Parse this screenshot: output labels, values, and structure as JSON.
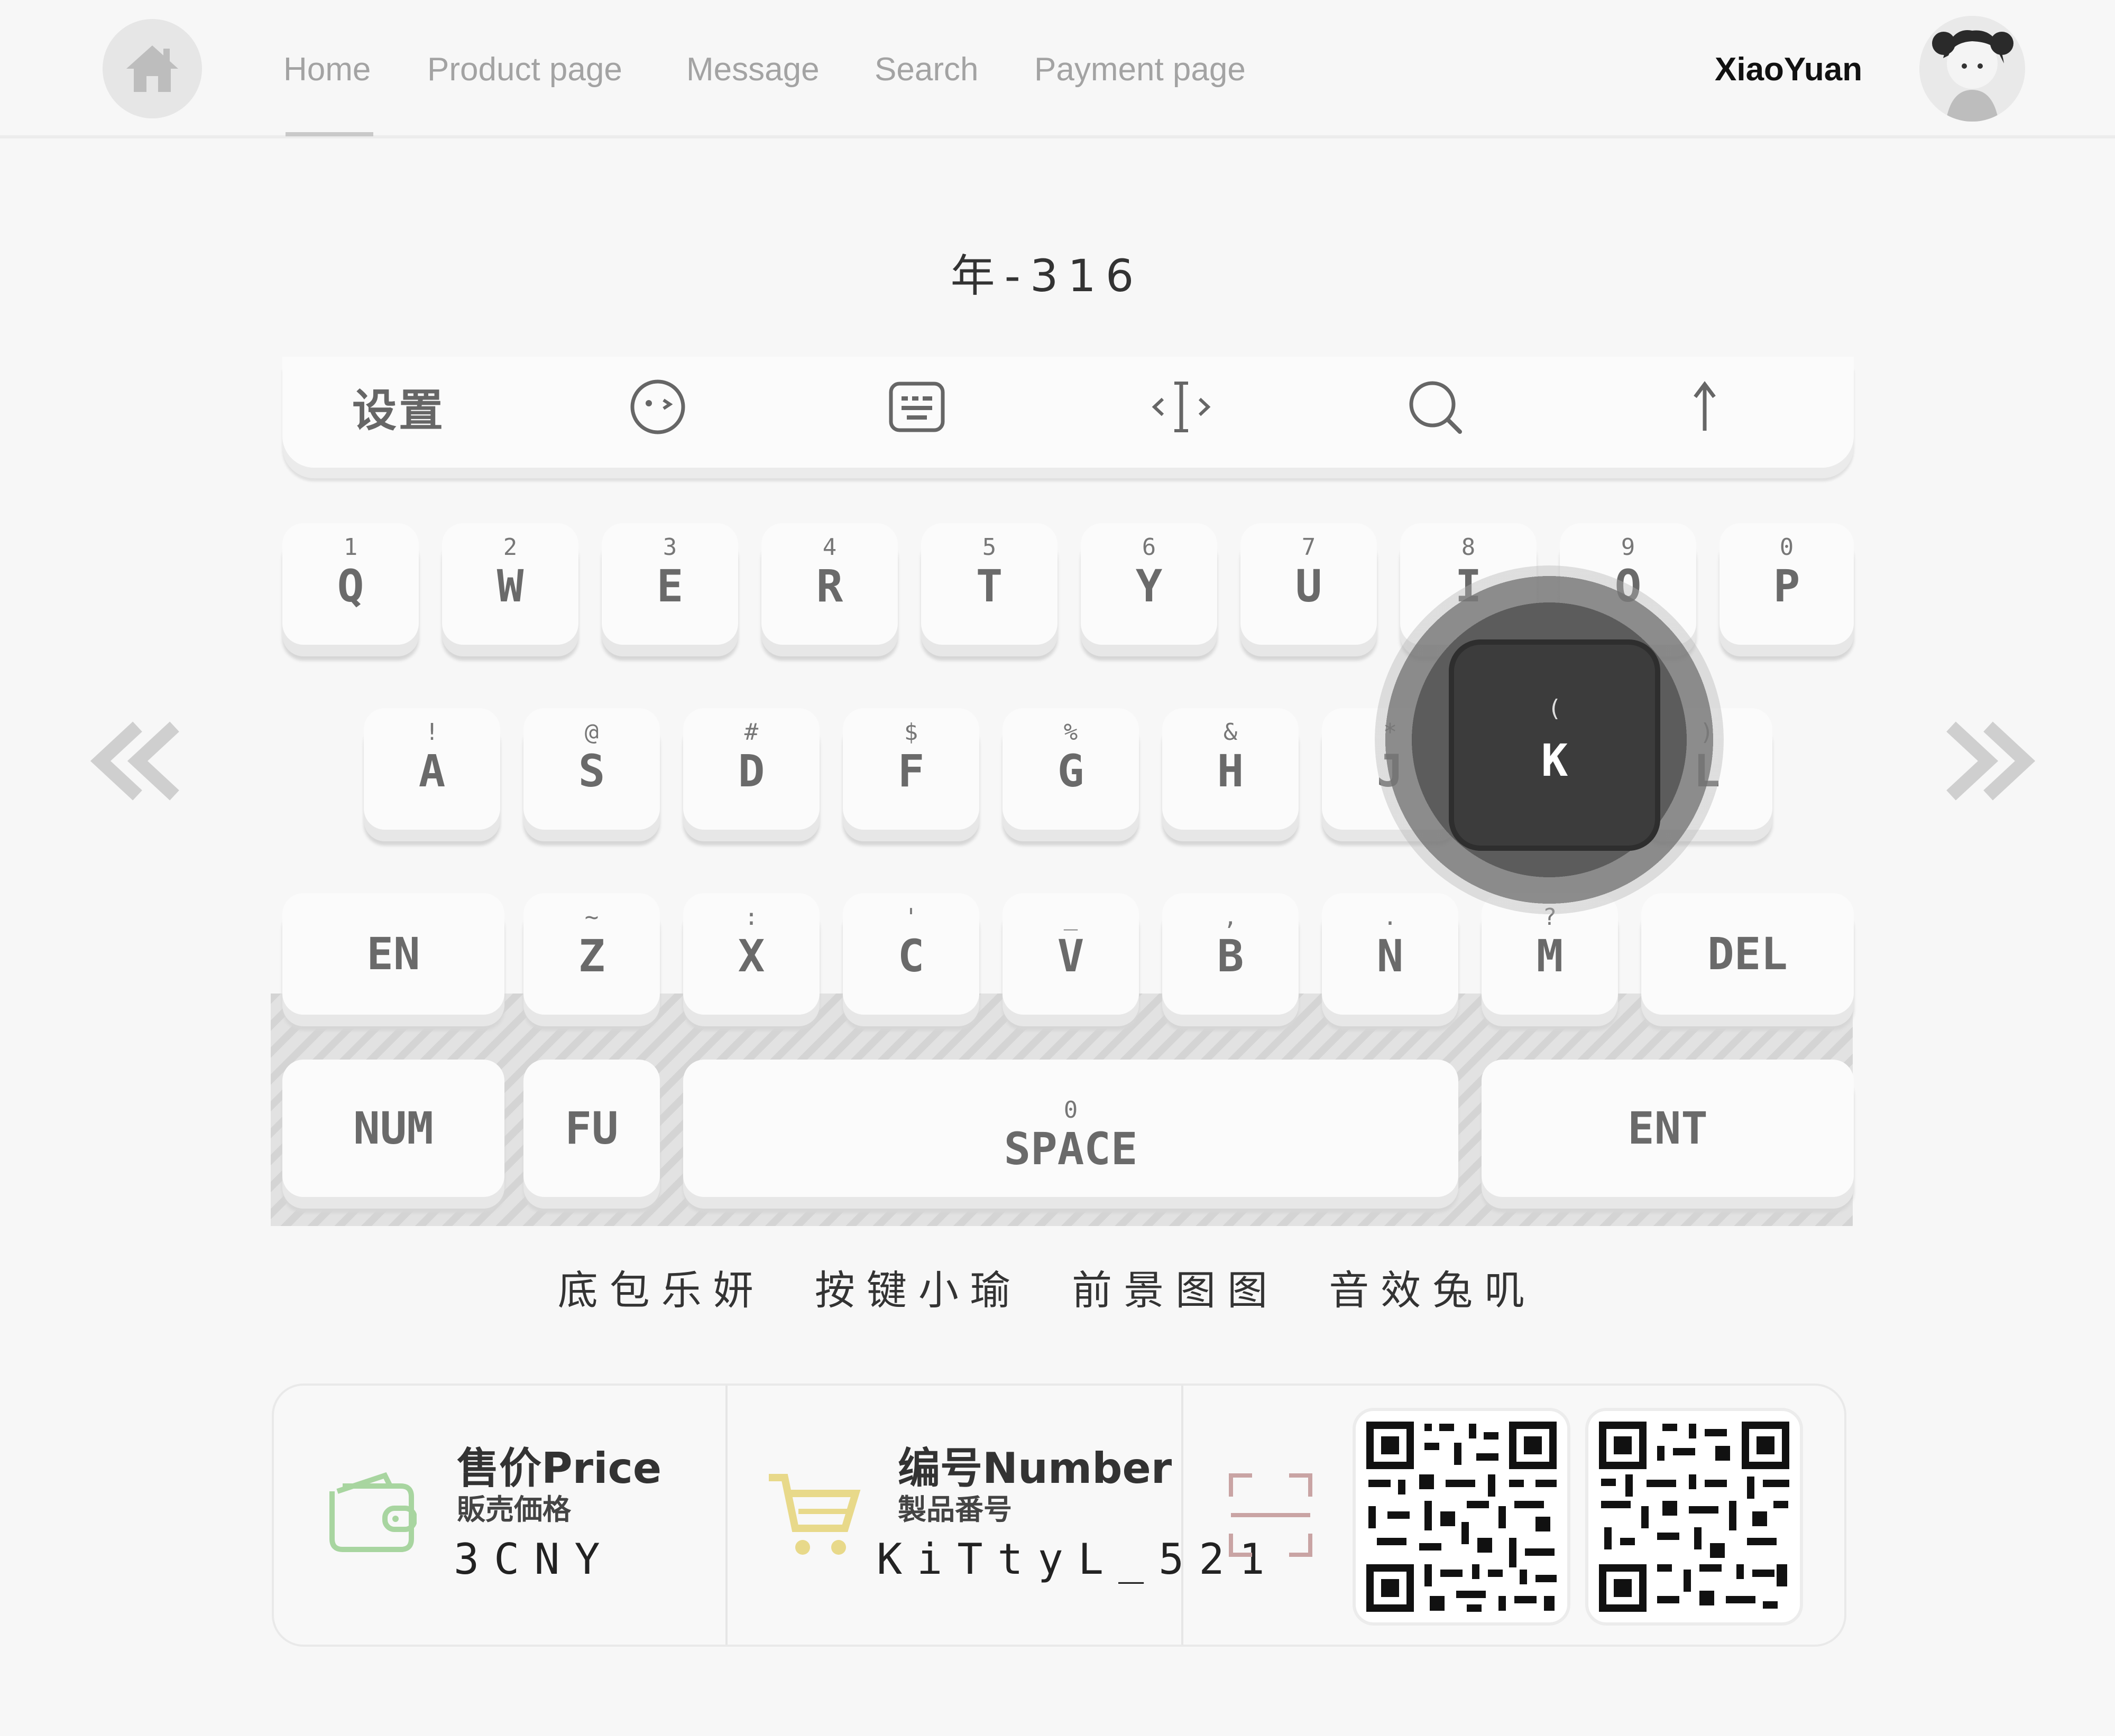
{
  "nav": {
    "links": [
      "Home",
      "Product page",
      "Message",
      "Search",
      "Payment page"
    ],
    "username": "XiaoYuan"
  },
  "product": {
    "title": "年-316"
  },
  "keyboard": {
    "toolbar": {
      "settings_label": "设置"
    },
    "row1": [
      {
        "sub": "1",
        "main": "Q"
      },
      {
        "sub": "2",
        "main": "W"
      },
      {
        "sub": "3",
        "main": "E"
      },
      {
        "sub": "4",
        "main": "R"
      },
      {
        "sub": "5",
        "main": "T"
      },
      {
        "sub": "6",
        "main": "Y"
      },
      {
        "sub": "7",
        "main": "U"
      },
      {
        "sub": "8",
        "main": "I"
      },
      {
        "sub": "9",
        "main": "O"
      },
      {
        "sub": "0",
        "main": "P"
      }
    ],
    "row2": [
      {
        "sub": "!",
        "main": "A"
      },
      {
        "sub": "@",
        "main": "S"
      },
      {
        "sub": "#",
        "main": "D"
      },
      {
        "sub": "$",
        "main": "F"
      },
      {
        "sub": "%",
        "main": "G"
      },
      {
        "sub": "&",
        "main": "H"
      },
      {
        "sub": "*",
        "main": "J"
      },
      {
        "sub": "(",
        "main": "K"
      },
      {
        "sub": ")",
        "main": "L"
      }
    ],
    "row3": [
      {
        "sub": "~",
        "main": "Z"
      },
      {
        "sub": ":",
        "main": "X"
      },
      {
        "sub": "'",
        "main": "C"
      },
      {
        "sub": "_",
        "main": "V"
      },
      {
        "sub": ",",
        "main": "B"
      },
      {
        "sub": ".",
        "main": "N"
      },
      {
        "sub": "?",
        "main": "M"
      }
    ],
    "func": {
      "en": "EN",
      "del": "DEL",
      "num": "NUM",
      "fu": "FU",
      "space_sub": "0",
      "space": "SPACE",
      "ent": "ENT"
    },
    "pressed": {
      "sub": "(",
      "main": "K"
    }
  },
  "credits": [
    "底包乐妍",
    "按键小瑜",
    "前景图图",
    "音效兔叽"
  ],
  "info": {
    "price_title": "售价Price",
    "price_sub": "販売価格",
    "price_value": "3CNY",
    "number_title": "编号Number",
    "number_sub": "製品番号",
    "number_value": "KiTtyL_521"
  },
  "colors": {
    "wallet": "#a8d5a0",
    "cart": "#e8d98a",
    "scan": "#c9a4a4",
    "accent_text": "#333333"
  }
}
